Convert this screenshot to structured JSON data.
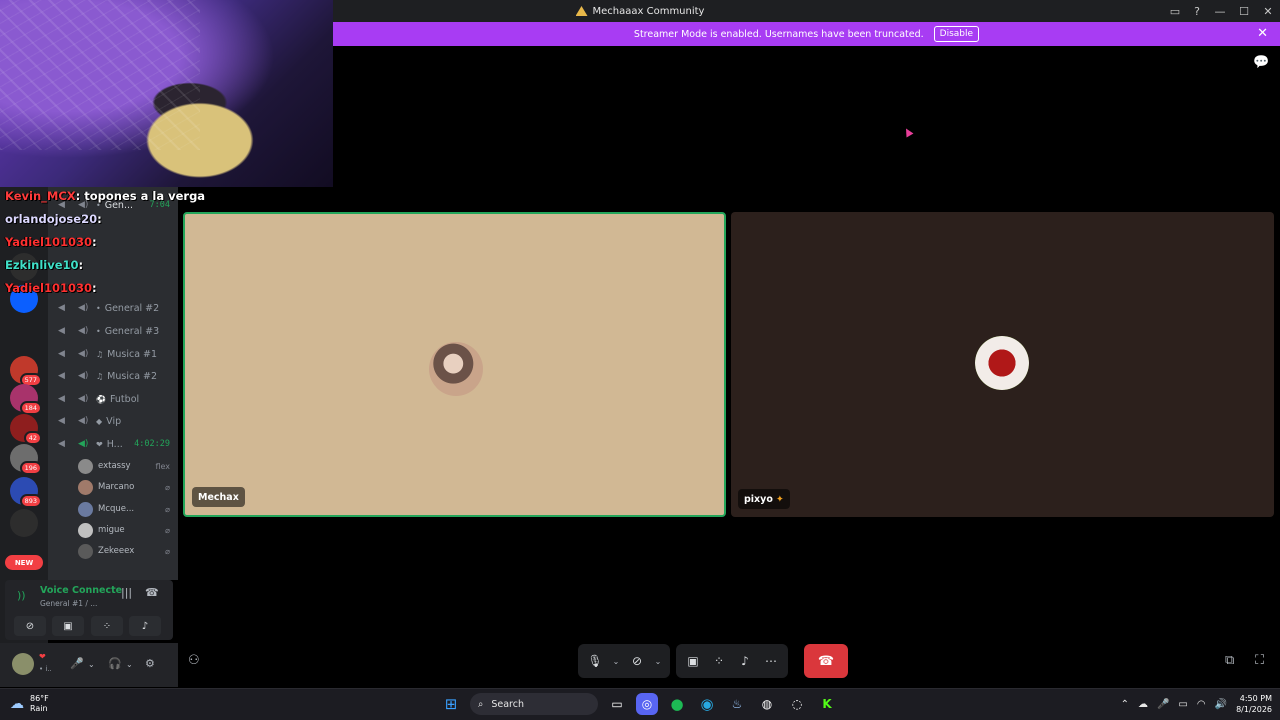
{
  "window": {
    "title": "Mechaaax Community"
  },
  "banner": {
    "message": "Streamer Mode is enabled. Usernames have been truncated.",
    "disable_label": "Disable"
  },
  "chat_overlay": [
    {
      "user": "Kevin_MCX",
      "sep": ":",
      "message": "topones a la verga",
      "color": "#ff3b3b"
    },
    {
      "user": "orlandojose20",
      "sep": ":",
      "message": "",
      "color": "#dcd8ff"
    },
    {
      "user": "Yadiel101030",
      "sep": ":",
      "message": "",
      "color": "#ff3030"
    },
    {
      "user": "Ezkinlive10",
      "sep": ":",
      "message": "",
      "color": "#3fe0c8"
    },
    {
      "user": "Yadiel101030",
      "sep": ":",
      "message": "",
      "color": "#ff3030"
    }
  ],
  "servers": [
    {
      "name": "server-swiss",
      "badge": "577",
      "color": "#c0392b"
    },
    {
      "name": "server-pink",
      "badge": "184",
      "color": "#a8336b"
    },
    {
      "name": "server-red",
      "badge": "42",
      "color": "#8e1e1e"
    },
    {
      "name": "server-gray",
      "badge": "196",
      "color": "#6d6d6d"
    },
    {
      "name": "server-blue",
      "badge": "893",
      "color": "#2c4bb3"
    },
    {
      "name": "server-dark",
      "badge": "",
      "color": "#2d2d2d"
    }
  ],
  "new_label": "NEW",
  "channel_list": {
    "channels": [
      {
        "label": "General #2"
      },
      {
        "label": "General #3"
      },
      {
        "label": "Musica #1"
      },
      {
        "label": "Musica #2"
      },
      {
        "label": "Futbol"
      },
      {
        "label": "Vip"
      },
      {
        "label": "H...",
        "time": "4:02:29"
      }
    ],
    "gen_label": "Gen...",
    "gen_time": "7:04",
    "users": [
      {
        "name": "extassy",
        "tag": "flex"
      },
      {
        "name": "Marcano",
        "tag": ""
      },
      {
        "name": "Mcque...",
        "tag": ""
      },
      {
        "name": "migue",
        "tag": ""
      },
      {
        "name": "Zekeeex",
        "tag": ""
      }
    ]
  },
  "voice_panel": {
    "status": "Voice Connecte",
    "channel": "General #1 / ..."
  },
  "user_panel": {
    "status": "• i.."
  },
  "tiles": [
    {
      "name": "Mechax"
    },
    {
      "name": "pixyo"
    }
  ],
  "taskbar": {
    "weather_temp": "86°F",
    "weather_cond": "Rain",
    "search_label": "Search",
    "time": "4:50 PM",
    "date": "8/1/2026"
  }
}
